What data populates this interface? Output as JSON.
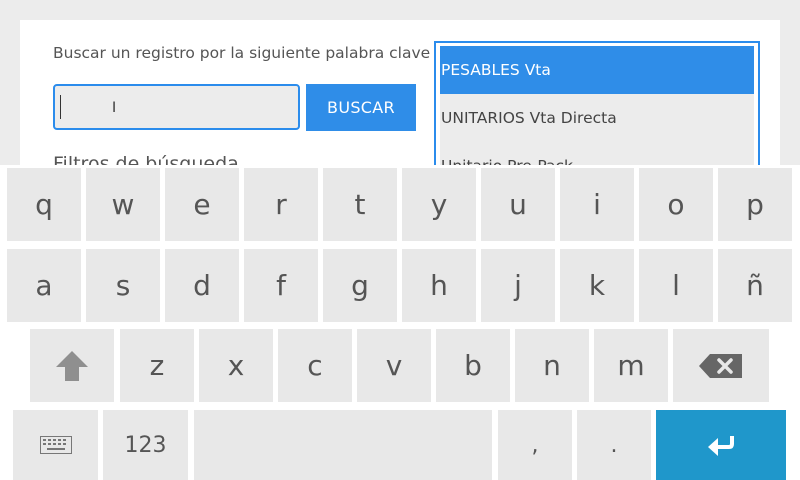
{
  "search": {
    "label": "Buscar un registro por la siguiente palabra clave",
    "input_value": "",
    "cursor_glyph": "I",
    "button_label": "BUSCAR"
  },
  "filters": {
    "label": "Filtros de búsqueda"
  },
  "list": {
    "items": [
      {
        "label": "PESABLES Vta",
        "selected": true
      },
      {
        "label": "UNITARIOS Vta Directa",
        "selected": false
      },
      {
        "label": "Unitario Pre-Pack",
        "selected": false
      }
    ]
  },
  "keyboard": {
    "row1": [
      "q",
      "w",
      "e",
      "r",
      "t",
      "y",
      "u",
      "i",
      "o",
      "p"
    ],
    "row2": [
      "a",
      "s",
      "d",
      "f",
      "g",
      "h",
      "j",
      "k",
      "l",
      "ñ"
    ],
    "row3": [
      "z",
      "x",
      "c",
      "v",
      "b",
      "n",
      "m"
    ],
    "row4": {
      "numbers": "123",
      "comma": ",",
      "period": "."
    },
    "icons": {
      "shift": "shift-arrow-up",
      "backspace": "backspace-x",
      "keyboard": "keyboard-layout",
      "enter": "enter-return-arrow"
    },
    "colors": {
      "key": "#e8e8e8",
      "enter": "#1f97cb",
      "accent": "#2f8de8"
    }
  }
}
